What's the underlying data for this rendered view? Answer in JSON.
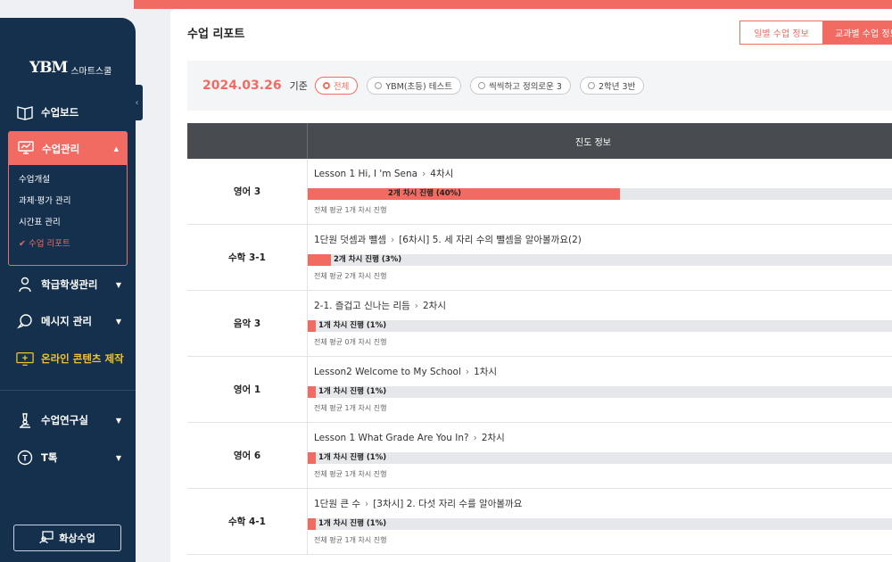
{
  "brand": {
    "logo_mark": "YBM",
    "logo_text": "스마트스쿨"
  },
  "sidebar": {
    "items": [
      {
        "label": "수업보드"
      },
      {
        "label": "수업관리"
      },
      {
        "label": "학급학생관리"
      },
      {
        "label": "메시지 관리"
      },
      {
        "label": "온라인 콘텐츠 제작"
      },
      {
        "label": "수업연구실"
      },
      {
        "label": "T톡"
      }
    ],
    "submenu": [
      "수업개설",
      "과제·평가 관리",
      "시간표 관리",
      "수업 리포트"
    ],
    "bottom_button": "화상수업"
  },
  "page": {
    "title": "수업 리포트",
    "tabs": {
      "daily": "일별 수업 정보",
      "subject": "교과별 수업 정보"
    }
  },
  "filter": {
    "date": "2024.03.26",
    "basis": "기준",
    "chips": [
      "전체",
      "YBM(초등) 테스트",
      "씩씩하고 정의로운 3",
      "2학년 3반"
    ]
  },
  "table": {
    "header": "진도 정보",
    "rows": [
      {
        "subject": "영어 3",
        "lesson": "Lesson 1 Hi, I 'm Sena",
        "session": "4차시",
        "progress_label": "2개 차시 진행 (40%)",
        "progress_pct": 40,
        "average": "전체 평균 1개 차시 진행"
      },
      {
        "subject": "수학 3-1",
        "lesson": "1단원 덧셈과 뺄셈",
        "lesson2": "[6차시] 5. 세 자리 수의 뺄셈을 알아볼까요(2)",
        "progress_label": "2개 차시 진행 (3%)",
        "progress_pct": 3,
        "average": "전체 평균 2개 차시 진행"
      },
      {
        "subject": "음악 3",
        "lesson": "2-1. 즐겁고 신나는 리듬",
        "session": "2차시",
        "progress_label": "1개 차시 진행 (1%)",
        "progress_pct": 1,
        "average": "전체 평균 0개 차시 진행"
      },
      {
        "subject": "영어 1",
        "lesson": "Lesson2 Welcome to My School",
        "session": "1차시",
        "progress_label": "1개 차시 진행 (1%)",
        "progress_pct": 1,
        "average": "전체 평균 1개 차시 진행"
      },
      {
        "subject": "영어 6",
        "lesson": "Lesson 1 What Grade Are You In?",
        "session": "2차시",
        "progress_label": "1개 차시 진행 (1%)",
        "progress_pct": 1,
        "average": "전체 평균 1개 차시 진행"
      },
      {
        "subject": "수학 4-1",
        "lesson": "1단원 큰 수",
        "lesson2": "[3차시] 2. 다섯 자리 수를 알아볼까요",
        "progress_label": "1개 차시 진행 (1%)",
        "progress_pct": 1,
        "average": "전체 평균 1개 차시 진행"
      }
    ]
  },
  "colors": {
    "accent": "#f26b62",
    "sidebar": "#14304d",
    "highlight": "#f2c232",
    "table_header": "#484b50"
  }
}
